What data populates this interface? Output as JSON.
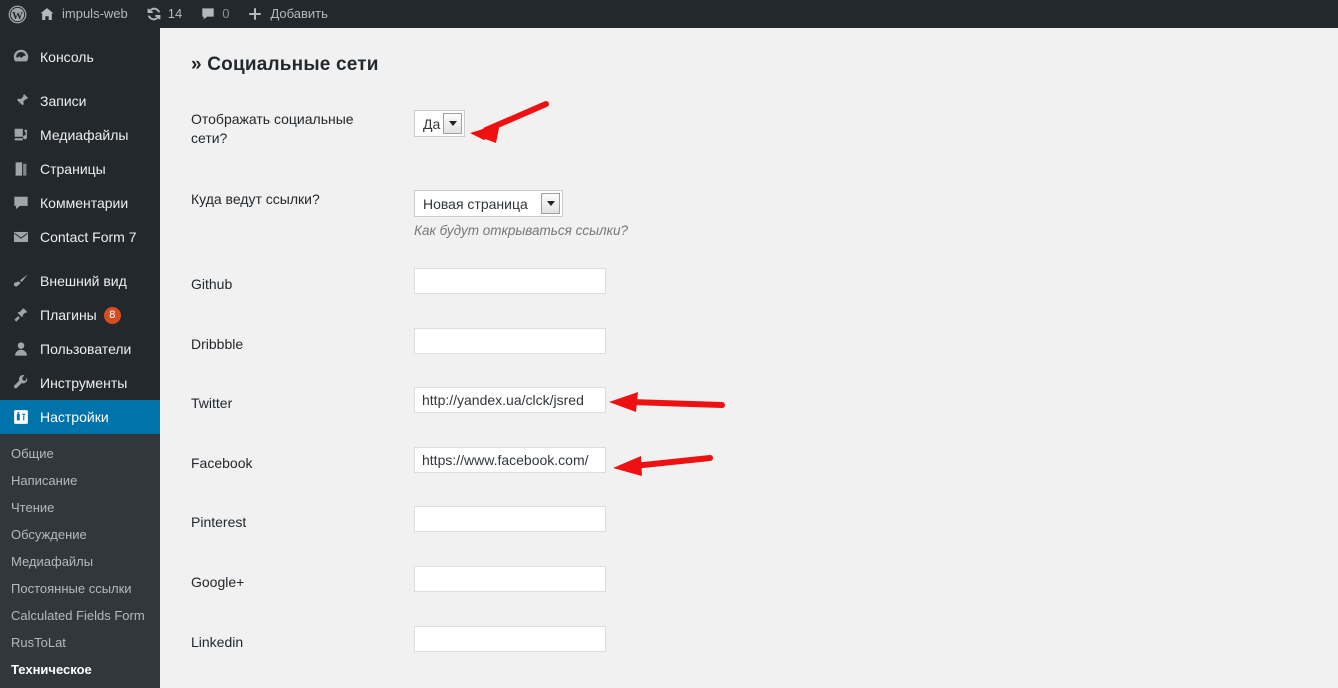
{
  "adminbar": {
    "logo_icon": "wordpress-logo-icon",
    "home_icon": "home-icon",
    "site_name": "impuls-web",
    "updates_icon": "updates-icon",
    "updates_count": "14",
    "comments_icon": "comment-bubble-icon",
    "comments_count": "0",
    "add_icon": "plus-icon",
    "add_label": "Добавить"
  },
  "sidebar": {
    "items": [
      {
        "label": "Консоль",
        "icon": "dashboard-icon",
        "active": false
      },
      {
        "label": "Записи",
        "icon": "pin-icon",
        "active": false
      },
      {
        "label": "Медиафайлы",
        "icon": "media-icon",
        "active": false
      },
      {
        "label": "Страницы",
        "icon": "pages-icon",
        "active": false
      },
      {
        "label": "Комментарии",
        "icon": "comment-bubble-icon",
        "active": false
      },
      {
        "label": "Contact Form 7",
        "icon": "envelope-icon",
        "active": false
      },
      {
        "label": "Внешний вид",
        "icon": "paintbrush-icon",
        "active": false
      },
      {
        "label": "Плагины",
        "icon": "plug-icon",
        "active": false,
        "badge": "8"
      },
      {
        "label": "Пользователи",
        "icon": "user-icon",
        "active": false
      },
      {
        "label": "Инструменты",
        "icon": "wrench-icon",
        "active": false
      },
      {
        "label": "Настройки",
        "icon": "settings-sliders-icon",
        "active": true
      }
    ],
    "submenu": [
      {
        "label": "Общие",
        "current": false
      },
      {
        "label": "Написание",
        "current": false
      },
      {
        "label": "Чтение",
        "current": false
      },
      {
        "label": "Обсуждение",
        "current": false
      },
      {
        "label": "Медиафайлы",
        "current": false
      },
      {
        "label": "Постоянные ссылки",
        "current": false
      },
      {
        "label": "Calculated Fields Form",
        "current": false
      },
      {
        "label": "RusToLat",
        "current": false
      },
      {
        "label": "Техническое",
        "current": true
      }
    ]
  },
  "main": {
    "page_title": "» Социальные сети",
    "show_social": {
      "label": "Отображать социальные сети?",
      "value": "Да"
    },
    "link_target": {
      "label": "Куда ведут ссылки?",
      "value": "Новая страница",
      "description": "Как будут открываться ссылки?"
    },
    "fields": [
      {
        "label": "Github",
        "value": "",
        "placeholder": ""
      },
      {
        "label": "Dribbble",
        "value": "",
        "placeholder": ""
      },
      {
        "label": "Twitter",
        "value": "http://yandex.ua/clck/jsred",
        "placeholder": ""
      },
      {
        "label": "Facebook",
        "value": "https://www.facebook.com/",
        "placeholder": ""
      },
      {
        "label": "Pinterest",
        "value": "",
        "placeholder": ""
      },
      {
        "label": "Google+",
        "value": "",
        "placeholder": ""
      },
      {
        "label": "Linkedin",
        "value": "",
        "placeholder": ""
      }
    ]
  },
  "annotations": {
    "arrow_color": "#ee1111",
    "arrows": [
      {
        "name": "arrow-to-show-social-select",
        "points_at": "Отображать социальные сети? select"
      },
      {
        "name": "arrow-to-twitter-field",
        "points_at": "Twitter input"
      },
      {
        "name": "arrow-to-facebook-field",
        "points_at": "Facebook input"
      }
    ]
  },
  "colors": {
    "adminbar_bg": "#23282d",
    "sidebar_bg": "#23282d",
    "submenu_bg": "#32373c",
    "active_blue": "#0073aa",
    "badge_orange": "#d54e21",
    "content_bg": "#f1f1f1",
    "arrow_red": "#ee1111"
  }
}
